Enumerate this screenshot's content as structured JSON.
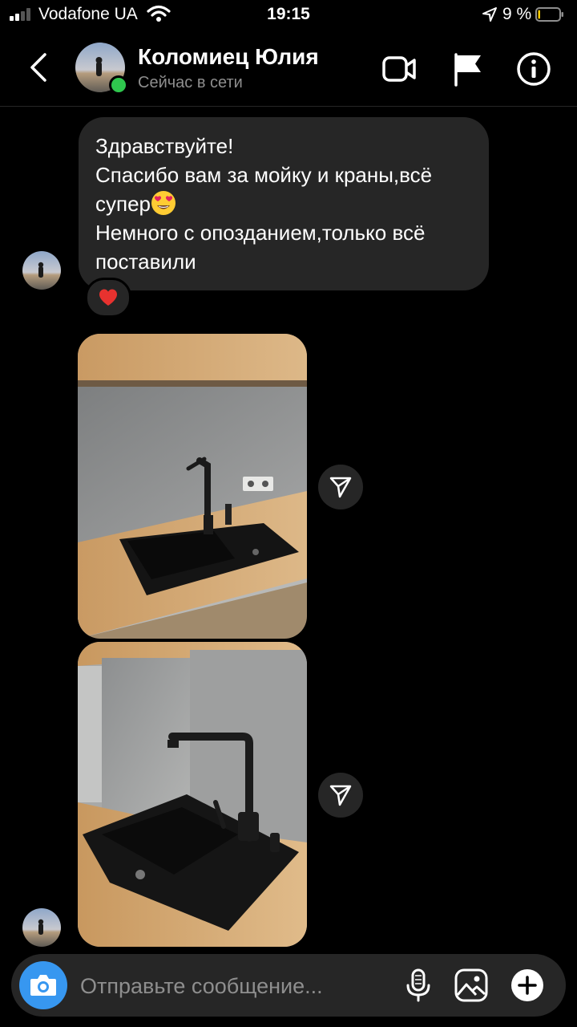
{
  "status_bar": {
    "carrier": "Vodafone UA",
    "time": "19:15",
    "battery_percent": "9 %",
    "battery_level": 0.09
  },
  "header": {
    "contact_name": "Коломиец Юлия",
    "status": "Сейчас в сети"
  },
  "messages": {
    "text_lines": [
      "Здравствуйте!",
      "Спасибо вам за мойку и краны,всё",
      "супер",
      "Немного с опозданием,только всё",
      "поставили"
    ],
    "reaction": "heart",
    "photos": [
      "kitchen-sink-photo-1",
      "kitchen-sink-photo-2"
    ]
  },
  "composer": {
    "placeholder": "Отправьте сообщение..."
  },
  "colors": {
    "background": "#000000",
    "bubble": "#262626",
    "accent": "#3797f0",
    "online": "#2fc74e",
    "muted_text": "#8e8e8e"
  },
  "icons": [
    "back-icon",
    "video-call-icon",
    "flag-icon",
    "info-icon",
    "share-icon",
    "camera-icon",
    "microphone-icon",
    "gallery-icon",
    "plus-icon"
  ]
}
